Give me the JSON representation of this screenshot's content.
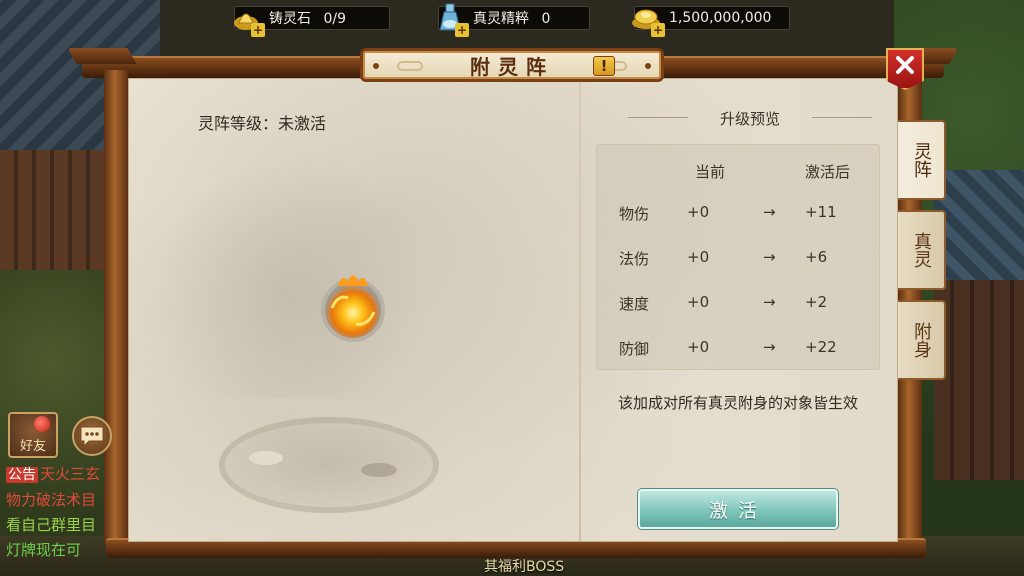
{
  "resources": [
    {
      "label": "铸灵石",
      "value": "0/9",
      "icon": "gold-ingot-icon"
    },
    {
      "label": "真灵精粹",
      "value": "0",
      "icon": "spirit-essence-bottle-icon"
    },
    {
      "label": "",
      "value": "1,500,000,000",
      "icon": "gold-ingots-icon"
    }
  ],
  "panel": {
    "title": "附灵阵",
    "info_label": "!"
  },
  "left": {
    "level_text": "灵阵等级：未激活"
  },
  "preview": {
    "header": "升级预览",
    "col_current": "当前",
    "col_after": "激活后",
    "arrow": "→",
    "rows": [
      {
        "name": "物伤",
        "current": "+0",
        "after": "+11"
      },
      {
        "name": "法伤",
        "current": "+0",
        "after": "+6"
      },
      {
        "name": "速度",
        "current": "+0",
        "after": "+2"
      },
      {
        "name": "防御",
        "current": "+0",
        "after": "+22"
      }
    ],
    "hint": "该加成对所有真灵附身的对象皆生效"
  },
  "activate_button": "激活",
  "tabs": [
    {
      "label": "灵阵",
      "active": true
    },
    {
      "label": "真灵",
      "active": false
    },
    {
      "label": "附身",
      "active": false
    }
  ],
  "chat": {
    "friend_label": "好友",
    "notice_tag": "公告",
    "lines": [
      "天火三玄",
      "物力破法术目",
      "看自己群里目",
      "灯牌现在可"
    ]
  },
  "bottom_text": "其福利BOSS",
  "colors": {
    "frame": "#8a4e22",
    "paper": "#e6dfcf",
    "button": "#7fc6bb",
    "close": "#d2302a"
  }
}
